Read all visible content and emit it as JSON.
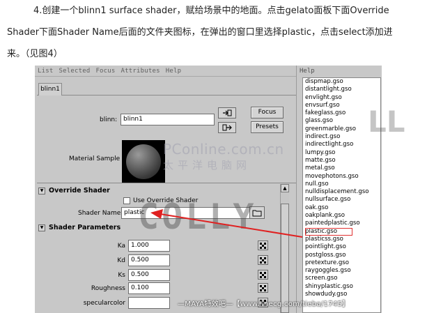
{
  "article": {
    "line1": "4.创建一个blinn1 surface shader，赋给场景中的地面。点击gelato面板下面Override",
    "line2": "Shader下面Shader Name后面的文件夹图标，在弹出的窗口里选择plastic，点击select添加进",
    "line3": "来。（见图4）"
  },
  "maya": {
    "menu": [
      "List",
      "Selected",
      "Focus",
      "Attributes",
      "Help"
    ],
    "tab_label": "blinn1",
    "node_label": "blinn:",
    "node_value": "blinn1",
    "focus_label": "Focus",
    "presets_label": "Presets",
    "material_sample_label": "Material Sample",
    "override_section": "Override Shader",
    "use_override_label": "Use Override Shader",
    "shader_name_label": "Shader Name",
    "shader_name_value": "plastic",
    "params_section": "Shader Parameters",
    "params": [
      {
        "label": "Ka",
        "value": "1.000"
      },
      {
        "label": "Kd",
        "value": "0.500"
      },
      {
        "label": "Ks",
        "value": "0.500"
      },
      {
        "label": "Roughness",
        "value": "0.100"
      },
      {
        "label": "specularcolor",
        "value": ""
      }
    ]
  },
  "help": {
    "header": "Help",
    "items": [
      "dispmap.gso",
      "distantlight.gso",
      "envlight.gso",
      "envsurf.gso",
      "fakeglass.gso",
      "glass.gso",
      "greenmarble.gso",
      "indirect.gso",
      "indirectlight.gso",
      "lumpy.gso",
      "matte.gso",
      "metal.gso",
      "movephotons.gso",
      "null.gso",
      "nulldisplacement.gso",
      "nullsurface.gso",
      "oak.gso",
      "oakplank.gso",
      "paintedplastic.gso",
      "plastic.gso",
      "plasticss.gso",
      "pointlight.gso",
      "postgloss.gso",
      "pretexture.gso",
      "raygoggles.gso",
      "screen.gso",
      "shinyplastic.gso",
      "showdudy.gso"
    ],
    "selected_index": 19
  },
  "watermarks": {
    "pconline": "PConline.com.cn",
    "cn": "太平洋电脑网",
    "colly": "COLLY",
    "colly_side": "LL",
    "footer": "—MAYA特效吧—【www.linecg.com/tieba/1745】"
  },
  "colors": {
    "arrow": "#e02020",
    "panel": "#c8c8c8"
  }
}
